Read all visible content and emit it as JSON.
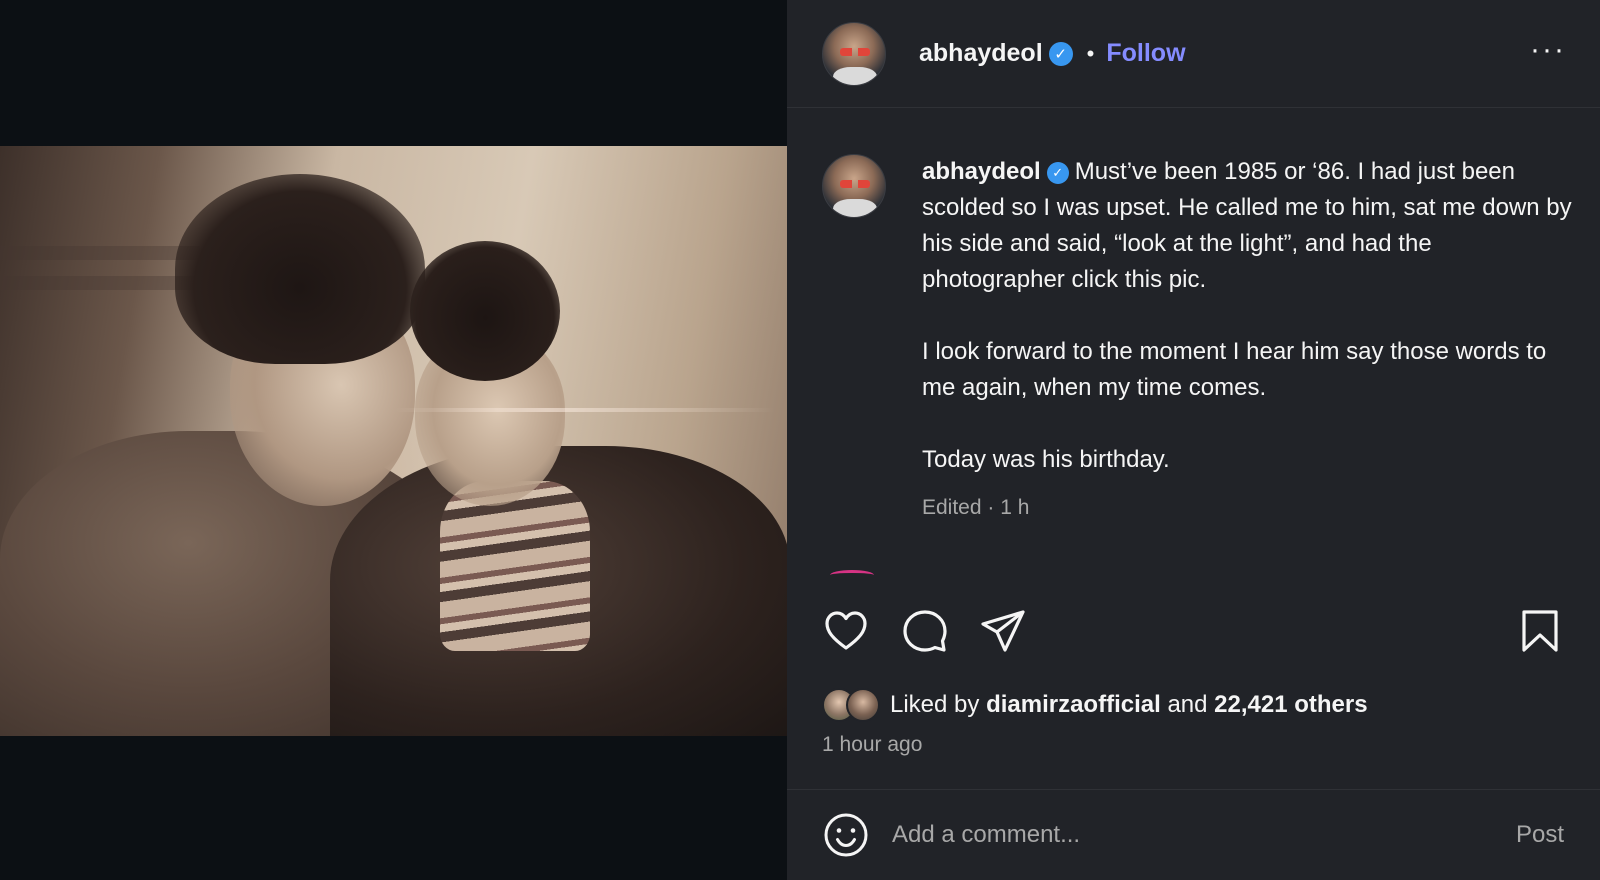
{
  "post": {
    "author": "abhaydeol",
    "verified_mark": "✓",
    "separator": "•",
    "follow_label": "Follow",
    "more_label": "···",
    "caption": {
      "line1": "Must’ve been 1985 or ‘86. I had just been scolded so I was upset. He called me to him, sat me down by his side and said, “look at the light”, and had the photographer click this pic.",
      "line2": "I look forward to the moment I hear him say those words to me again, when my time comes.",
      "line3": "Today was his birthday."
    },
    "meta": "Edited · 1 h",
    "likes": {
      "prefix": "Liked by ",
      "liker": "diamirzaofficial",
      "middle": " and ",
      "count": "22,421 others"
    },
    "time_ago": "1 hour ago"
  },
  "comment": {
    "placeholder": "Add a comment...",
    "post_label": "Post"
  },
  "icons": {
    "like": "heart-icon",
    "comment": "comment-icon",
    "share": "share-icon",
    "save": "bookmark-icon",
    "emoji": "smiley-icon"
  },
  "colors": {
    "panel_bg": "#212328",
    "media_bg": "#0c1014",
    "follow": "#858cff",
    "verified": "#3897f0",
    "muted_text": "#a8a8a8"
  }
}
